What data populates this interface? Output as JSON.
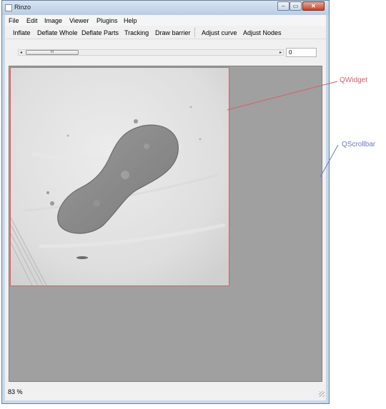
{
  "window": {
    "title": "Rinzo",
    "minimize": "–",
    "maximize": "▭",
    "close": "✕"
  },
  "menu": [
    "File",
    "Edit",
    "Image",
    "Viewer",
    "Plugins",
    "Help"
  ],
  "toolbar": [
    "Inflate",
    "Deflate Whole",
    "Deflate Parts",
    "Tracking",
    "Draw barrier",
    "Adjust curve",
    "Adjust Nodes"
  ],
  "slider": {
    "left_arrow": "◂",
    "right_arrow": "▸",
    "thumb_grip": "III",
    "value": "0"
  },
  "status": {
    "zoom": "83 %"
  },
  "annotations": {
    "widget_label": "QWidget",
    "widget_color": "#d65f67",
    "scrollbar_label": "QScrollbar",
    "scrollbar_color": "#6a79b8"
  }
}
